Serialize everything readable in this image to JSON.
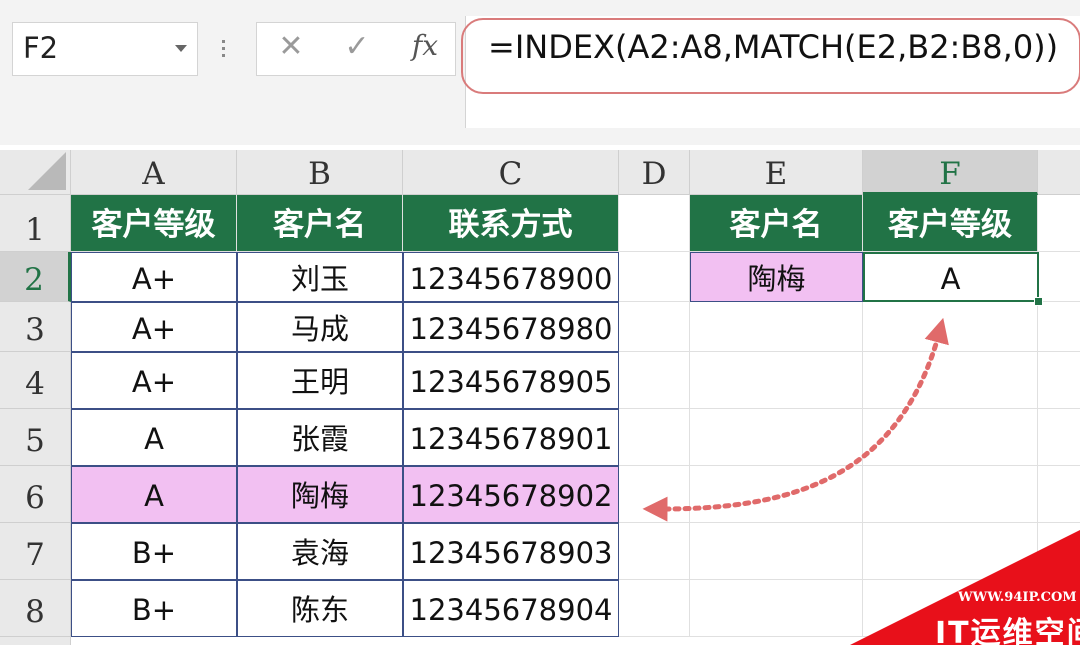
{
  "formula_bar": {
    "name_box": "F2",
    "cancel_icon": "✕",
    "enter_icon": "✓",
    "fx_label": "fx",
    "formula": "=INDEX(A2:A8,MATCH(E2,B2:B8,0))"
  },
  "columns": [
    "A",
    "B",
    "C",
    "D",
    "E",
    "F"
  ],
  "active_column": "F",
  "rows": [
    "1",
    "2",
    "3",
    "4",
    "5",
    "6",
    "7",
    "8"
  ],
  "active_row": "2",
  "table": {
    "headers": [
      "客户等级",
      "客户名",
      "联系方式"
    ],
    "rows": [
      [
        "A+",
        "刘玉",
        "12345678900"
      ],
      [
        "A+",
        "马成",
        "12345678980"
      ],
      [
        "A+",
        "王明",
        "12345678905"
      ],
      [
        "A",
        "张霞",
        "12345678901"
      ],
      [
        "A",
        "陶梅",
        "12345678902"
      ],
      [
        "B+",
        "袁海",
        "12345678903"
      ],
      [
        "B+",
        "陈东",
        "12345678904"
      ]
    ]
  },
  "lookup": {
    "headers": [
      "客户名",
      "客户等级"
    ],
    "input": "陶梅",
    "result": "A"
  },
  "colors": {
    "header_green": "#217346",
    "highlight_pink": "#f2c0f2",
    "arrow": "#e06a6a",
    "watermark_red": "#e8101a"
  },
  "watermark": {
    "url": "WWW.94IP.COM",
    "name": "IT运维空间"
  }
}
